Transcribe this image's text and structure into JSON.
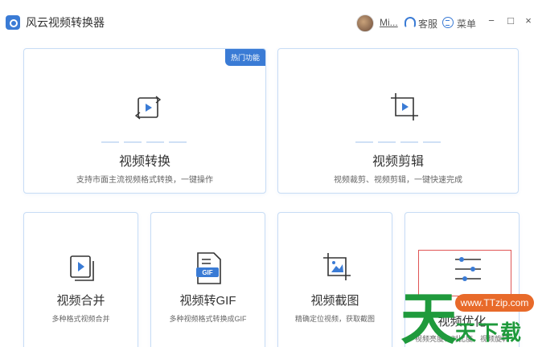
{
  "app": {
    "title": "风云视频转换器"
  },
  "header": {
    "user_name": "Mi...",
    "service_label": "客服",
    "menu_label": "菜单",
    "minimize": "−",
    "maximize": "□",
    "close": "×"
  },
  "cards": {
    "convert": {
      "title": "视频转换",
      "desc": "支持市面主流视频格式转换，一键操作",
      "badge": "热门功能",
      "icon": "video-convert-icon"
    },
    "edit": {
      "title": "视频剪辑",
      "desc": "视频裁剪、视频剪辑，一键快速完成",
      "icon": "video-crop-icon"
    },
    "merge": {
      "title": "视频合并",
      "desc": "多种格式视频合并",
      "icon": "video-merge-icon"
    },
    "to_gif": {
      "title": "视频转GIF",
      "desc": "多种视频格式转换成GIF",
      "icon": "gif-file-icon"
    },
    "screenshot": {
      "title": "视频截图",
      "desc": "精确定位视频，获取截图",
      "icon": "image-crop-icon"
    },
    "optimize": {
      "title": "视频优化",
      "desc": "视频亮度、对比度、视频旋转",
      "icon": "sliders-icon"
    }
  },
  "watermark": {
    "site": "www.TTzip.com",
    "logo_char": "天",
    "brand": "天下载"
  },
  "colors": {
    "accent": "#3a7bd5",
    "card_border": "#c7dcf5",
    "highlight": "#e05555",
    "watermark_green": "#1f9a3c",
    "watermark_orange": "#e86a2a"
  }
}
